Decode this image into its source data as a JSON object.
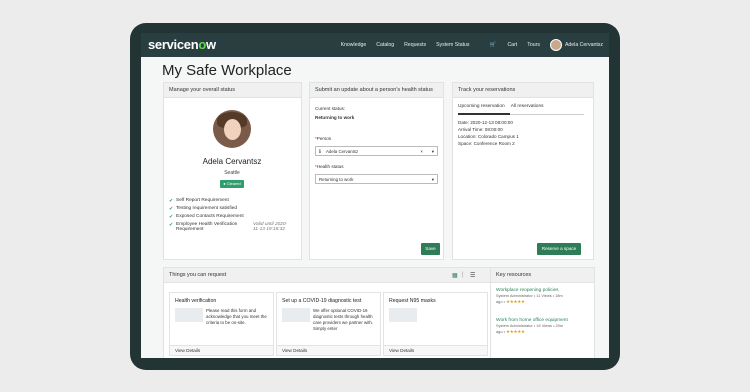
{
  "app": {
    "logo_text": "servicenow",
    "logo_prefix": "servicen",
    "logo_o": "o",
    "logo_suffix": "w"
  },
  "nav": {
    "items": [
      "Knowledge",
      "Catalog",
      "Requests",
      "System Status",
      "Cart",
      "Tours"
    ],
    "user_name": "Adela Cervantsz",
    "cart_icon": "cart-icon"
  },
  "page": {
    "title": "My Safe Workplace"
  },
  "status_panel": {
    "header": "Manage your overall status",
    "name": "Adela Cervantsz",
    "location": "Seattle",
    "badge": "Cleared",
    "requirements": [
      "Self Report Requirement",
      "Testing requirement satisfied",
      "Exposed Contacts Requirement",
      "Employee Health Verification Requirement"
    ],
    "valid_until": "Valid until 2020-11-13 19:18:32"
  },
  "update_panel": {
    "header": "Submit an update about a person's health status",
    "current_status_label": "Current status:",
    "current_status_value": "Returning to work",
    "person_label": "Person",
    "person_value": "Adela Cervantsz",
    "health_label": "Health status",
    "health_value": "Returning to work",
    "save_label": "Save"
  },
  "reservations_panel": {
    "header": "Track your reservations",
    "tabs": [
      "Upcoming reservation",
      "All reservations"
    ],
    "details": [
      "Date: 2020-12-13 08:00:00",
      "Arrival Time: 08:00:00",
      "Location: Colorado Campus 1",
      "Space: Conference Room 2"
    ],
    "reserve_label": "Reserve a space"
  },
  "request_panel": {
    "header": "Things you can request",
    "cards": [
      {
        "title": "Health verification",
        "desc": "Please read this form and acknowledge that you meet the criteria to be on-site.",
        "foot": "View Details"
      },
      {
        "title": "Set up a COVID-19 diagnostic test",
        "desc": "We offer optional COVID-19 diagnostic tests through health care providers we partner with. Simply enter",
        "foot": "View Details"
      },
      {
        "title": "Request N95 masks",
        "desc": "",
        "foot": "View Details"
      }
    ]
  },
  "resources_panel": {
    "header": "Key resources",
    "items": [
      {
        "title": "Workplace reopening policies",
        "meta1": "System Administrator • 11 Views • 18m",
        "meta2": "ago •",
        "stars": "★★★★★"
      },
      {
        "title": "Work from home office equipment",
        "meta1": "System Administrator • 16 Views • 29m",
        "meta2": "ago •",
        "stars": "★★★★★"
      }
    ]
  }
}
